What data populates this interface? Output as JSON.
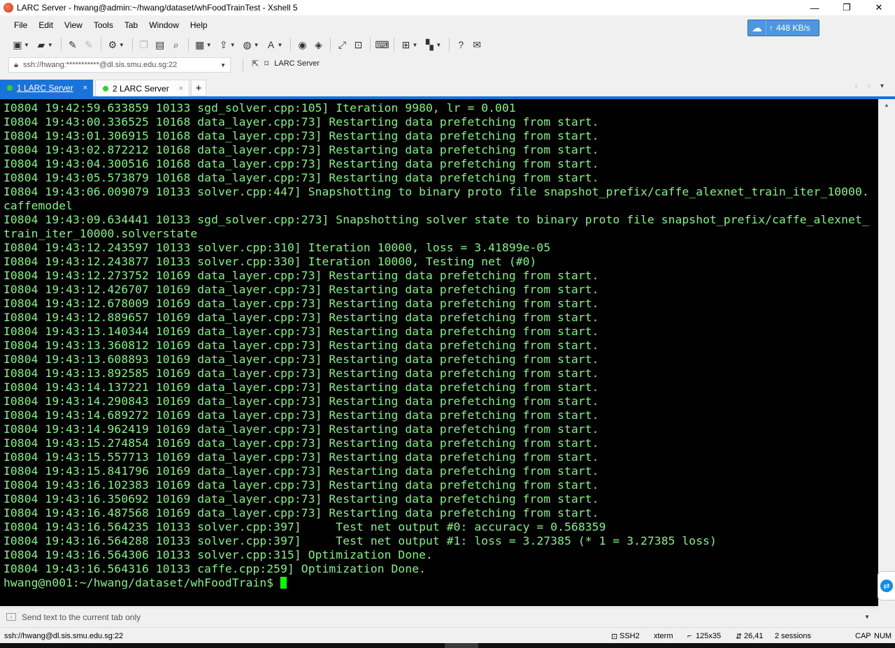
{
  "window": {
    "title": "LARC Server - hwang@admin:~/hwang/dataset/whFoodTrainTest - Xshell 5",
    "minimize": "—",
    "maximize": "❐",
    "close": "✕"
  },
  "menu": [
    "File",
    "Edit",
    "View",
    "Tools",
    "Tab",
    "Window",
    "Help"
  ],
  "netspeed": {
    "arrow": "↑",
    "rate": "448 KB/s"
  },
  "address": {
    "value": "ssh://hwang:***********@dl.sis.smu.edu.sg:22"
  },
  "quick_connect": {
    "label": "LARC Server"
  },
  "tabs": [
    {
      "label": "1 LARC Server",
      "close": "×"
    },
    {
      "label": "2 LARC Server",
      "close": "×"
    }
  ],
  "tab_add": "+",
  "terminal": {
    "lines": [
      "I0804 19:42:59.633859 10133 sgd_solver.cpp:105] Iteration 9980, lr = 0.001",
      "I0804 19:43:00.336525 10168 data_layer.cpp:73] Restarting data prefetching from start.",
      "I0804 19:43:01.306915 10168 data_layer.cpp:73] Restarting data prefetching from start.",
      "I0804 19:43:02.872212 10168 data_layer.cpp:73] Restarting data prefetching from start.",
      "I0804 19:43:04.300516 10168 data_layer.cpp:73] Restarting data prefetching from start.",
      "I0804 19:43:05.573879 10168 data_layer.cpp:73] Restarting data prefetching from start.",
      "I0804 19:43:06.009079 10133 solver.cpp:447] Snapshotting to binary proto file snapshot_prefix/caffe_alexnet_train_iter_10000.",
      "caffemodel",
      "I0804 19:43:09.634441 10133 sgd_solver.cpp:273] Snapshotting solver state to binary proto file snapshot_prefix/caffe_alexnet_",
      "train_iter_10000.solverstate",
      "I0804 19:43:12.243597 10133 solver.cpp:310] Iteration 10000, loss = 3.41899e-05",
      "I0804 19:43:12.243877 10133 solver.cpp:330] Iteration 10000, Testing net (#0)",
      "I0804 19:43:12.273752 10169 data_layer.cpp:73] Restarting data prefetching from start.",
      "I0804 19:43:12.426707 10169 data_layer.cpp:73] Restarting data prefetching from start.",
      "I0804 19:43:12.678009 10169 data_layer.cpp:73] Restarting data prefetching from start.",
      "I0804 19:43:12.889657 10169 data_layer.cpp:73] Restarting data prefetching from start.",
      "I0804 19:43:13.140344 10169 data_layer.cpp:73] Restarting data prefetching from start.",
      "I0804 19:43:13.360812 10169 data_layer.cpp:73] Restarting data prefetching from start.",
      "I0804 19:43:13.608893 10169 data_layer.cpp:73] Restarting data prefetching from start.",
      "I0804 19:43:13.892585 10169 data_layer.cpp:73] Restarting data prefetching from start.",
      "I0804 19:43:14.137221 10169 data_layer.cpp:73] Restarting data prefetching from start.",
      "I0804 19:43:14.290843 10169 data_layer.cpp:73] Restarting data prefetching from start.",
      "I0804 19:43:14.689272 10169 data_layer.cpp:73] Restarting data prefetching from start.",
      "I0804 19:43:14.962419 10169 data_layer.cpp:73] Restarting data prefetching from start.",
      "I0804 19:43:15.274854 10169 data_layer.cpp:73] Restarting data prefetching from start.",
      "I0804 19:43:15.557713 10169 data_layer.cpp:73] Restarting data prefetching from start.",
      "I0804 19:43:15.841796 10169 data_layer.cpp:73] Restarting data prefetching from start.",
      "I0804 19:43:16.102383 10169 data_layer.cpp:73] Restarting data prefetching from start.",
      "I0804 19:43:16.350692 10169 data_layer.cpp:73] Restarting data prefetching from start.",
      "I0804 19:43:16.487568 10169 data_layer.cpp:73] Restarting data prefetching from start.",
      "I0804 19:43:16.564235 10133 solver.cpp:397]     Test net output #0: accuracy = 0.568359",
      "I0804 19:43:16.564288 10133 solver.cpp:397]     Test net output #1: loss = 3.27385 (* 1 = 3.27385 loss)",
      "I0804 19:43:16.564306 10133 solver.cpp:315] Optimization Done.",
      "I0804 19:43:16.564316 10133 caffe.cpp:259] Optimization Done."
    ],
    "prompt": "hwang@n001:~/hwang/dataset/whFoodTrain$ "
  },
  "send_bar": {
    "placeholder": "Send text to the current tab only"
  },
  "status": {
    "connection": "ssh://hwang@dl.sis.smu.edu.sg:22",
    "protocol": "SSH2",
    "term_type": "xterm",
    "size": "125x35",
    "cursor_pos": "26,41",
    "sessions": "2 sessions",
    "cap": "CAP",
    "num": "NUM"
  },
  "colors": {
    "terminal_bg": "#000000",
    "terminal_text": "#7ff57f",
    "cursor": "#00ff00",
    "active_tab": "#1a73d8",
    "netspeed_bg": "#4d97e0"
  },
  "icons": [
    "app-icon",
    "new-session-icon",
    "open-folder-icon",
    "disconnect-icon",
    "reconnect-icon",
    "properties-icon",
    "copy-icon",
    "paste-icon",
    "find-icon",
    "print-icon",
    "transfer-icon",
    "globe-icon",
    "font-icon",
    "xftp-icon",
    "xmanager-icon",
    "fullscreen-icon",
    "lock-icon",
    "keyboard-icon",
    "new-tab-icon",
    "layout-icon",
    "help-icon",
    "chat-icon",
    "bookmark-icon",
    "teamviewer-icon"
  ]
}
